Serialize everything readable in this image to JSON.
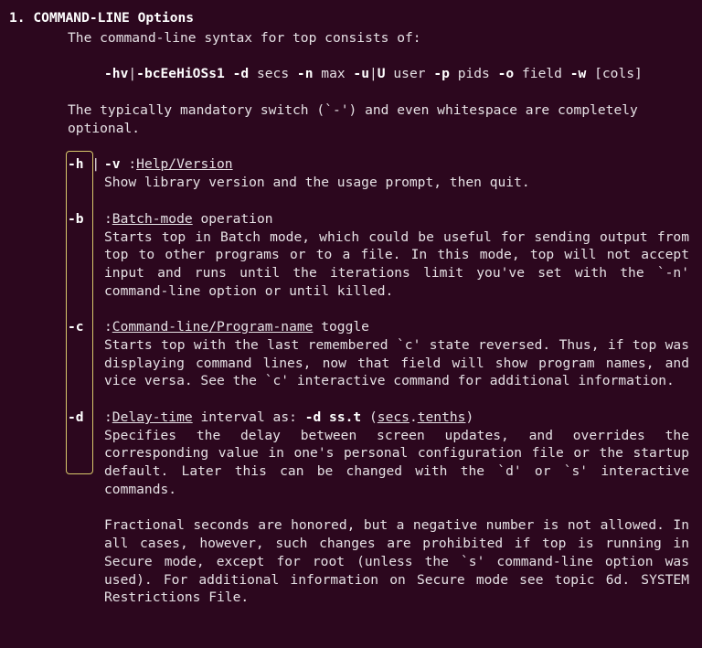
{
  "heading": {
    "number": "1.",
    "title": "COMMAND-LINE Options"
  },
  "intro_line": "The command-line syntax for top consists of:",
  "syntax_pieces": {
    "p1": "-hv",
    "sep1": "|",
    "p2": "-bcEeHiOSs1",
    "p3": " -d ",
    "a3": "secs",
    "p4": " -n ",
    "a4": "max",
    "p5": " -u",
    "sep2": "|",
    "p6": "U ",
    "a6": "user",
    "p7": " -p ",
    "a7": "pids",
    "p8": " -o ",
    "a8": "field",
    "p9": " -w ",
    "a9": "[cols]"
  },
  "mandatory_note": "The typically mandatory switch (`-') and even whitespace are completely optional.",
  "options": {
    "h": {
      "flag": "-h",
      "sep": " |",
      "extra_flag": "  -v",
      "title_prefix": "  :",
      "title": "Help/Version",
      "title_suffix": "",
      "desc": "Show library version and the usage prompt, then quit."
    },
    "b": {
      "flag": "-b",
      "title_prefix": ":",
      "title": "Batch-mode",
      "title_suffix": " operation",
      "desc": "Starts top in Batch mode, which could be useful for sending output from  top  to other programs or to a file.  In this mode, top will not accept input and runs until the iterations  limit  you've  set with the `-n' command-line option or until killed."
    },
    "c": {
      "flag": "-c",
      "title_prefix": ":",
      "title": "Command-line/Program-name",
      "title_suffix": " toggle",
      "desc": "Starts  top with the last remembered `c' state reversed.  Thus, if top was displaying command lines, now that field will show program names,  and  vice  versa.   See  the  `c'  interactive command for additional information."
    },
    "d": {
      "flag": "-d",
      "title_prefix": ":",
      "title": "Delay-time",
      "title_suffix_lead": " interval as:  ",
      "title_bold": "-d ss.t",
      "title_paren_open": " (",
      "title_u1": "secs",
      "title_dot": ".",
      "title_u2": "tenths",
      "title_paren_close": ")",
      "desc": "Specifies the delay between  screen  updates,  and  overrides  the corresponding  value  in  one's personal configuration file or the startup default.  Later this can be changed with the  `d'  or  `s' interactive commands.",
      "desc2": "Fractional  seconds  are  honored,  but  a  negative number is not allowed.  In all cases, however, such changes  are  prohibited  if top  is  running  in  Secure mode, except for root (unless the `s' command-line option was  used).   For  additional  information  on Secure mode see topic 6d. SYSTEM Restrictions File."
    }
  }
}
